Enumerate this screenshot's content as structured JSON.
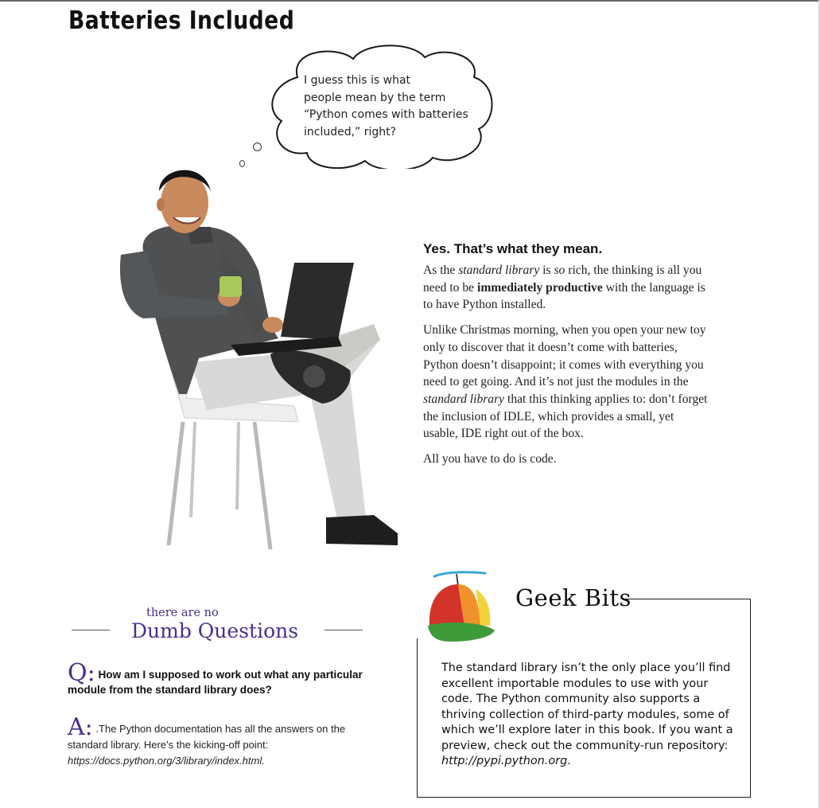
{
  "page": {
    "title": "Batteries Included"
  },
  "thought_bubble": {
    "text": "I guess this is what\npeople mean by the term\n“Python comes with batteries\nincluded,” right?"
  },
  "answer": {
    "heading": "Yes. That’s what they mean.",
    "p1": {
      "a": "As the ",
      "b": "standard library",
      "c": " is ",
      "d": "so",
      "e": " rich, the thinking is all you need to be ",
      "f": "immediately productive",
      "g": " with the language is to have Python installed."
    },
    "p2": {
      "a": "Unlike Christmas morning, when you open your new toy only to discover that it doesn’t come with batteries, Python doesn’t disappoint; it comes with everything you need to get going. And it’s not just the modules in the ",
      "b": "standard library",
      "c": " that this thinking applies to: don’t forget the inclusion of IDLE, which provides a small, yet usable, IDE right out of the box."
    },
    "p3": "All you have to do is code."
  },
  "dumb_questions": {
    "header_small": "there are no",
    "header_big": "Dumb Questions",
    "q_letter": "Q:",
    "question": "How am I supposed to work out what any particular module from the standard library does?",
    "a_letter": "A:",
    "answer_text": ".The Python documentation has all the answers on the standard library. Here’s the kicking-off point: ",
    "answer_link": "https://docs.python.org/3/library/index.html",
    "answer_end": "."
  },
  "geek_bits": {
    "title": "Geek Bits",
    "text": "The standard library isn’t the only place you’ll find excellent importable modules to use with your code. The Python community also supports a thriving collection of third-party modules, some of which we’ll explore later in this book. If you want a preview, check out the community-run repository: ",
    "link": "http://pypi.python.org",
    "text_end": "."
  },
  "colors": {
    "accent_purple": "#4a2f8f",
    "cap_red": "#d2342a",
    "cap_orange": "#f0922a",
    "cap_yellow": "#f2d43a",
    "cap_green": "#3f9a3a",
    "propeller": "#3aa8d8"
  }
}
